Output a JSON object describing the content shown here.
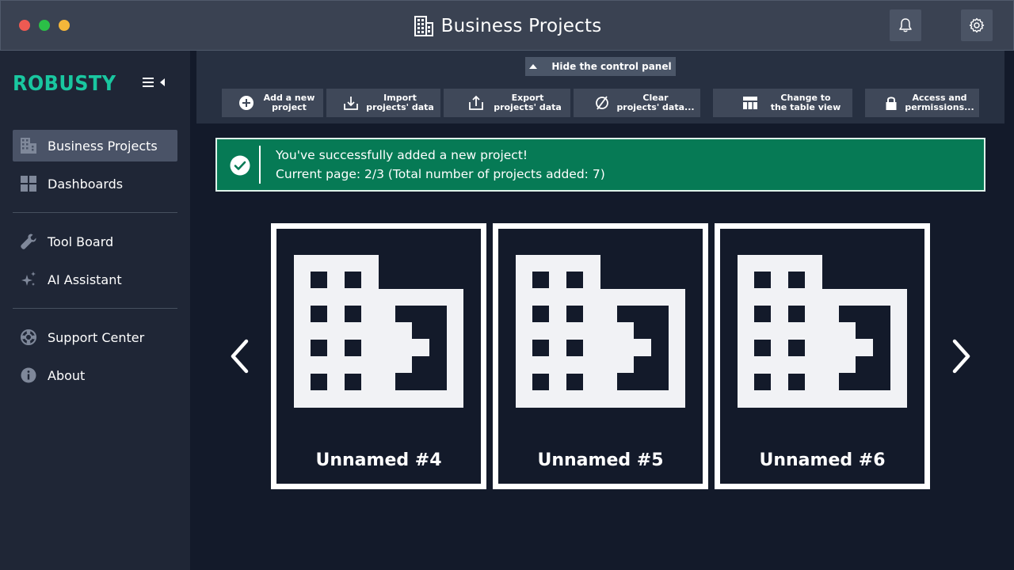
{
  "window": {
    "title": "Business Projects",
    "title_icon": "building-icon",
    "traffic_lights": [
      "#ee5a52",
      "#2bbf47",
      "#f5b73a"
    ],
    "notification_icon": "bell-icon",
    "settings_icon": "gear-icon"
  },
  "sidebar": {
    "logo": "ROBUSTY",
    "logo_color": "#19c7a0",
    "items": [
      {
        "label": "Business Projects",
        "icon": "building-icon",
        "active": true
      },
      {
        "label": "Dashboards",
        "icon": "grid-icon",
        "active": false
      },
      {
        "label": "Tool Board",
        "icon": "wrench-icon",
        "active": false
      },
      {
        "label": "AI Assistant",
        "icon": "sparkle-icon",
        "active": false
      },
      {
        "label": "Support Center",
        "icon": "lifebuoy-icon",
        "active": false
      },
      {
        "label": "About",
        "icon": "info-icon",
        "active": false
      }
    ]
  },
  "control_panel": {
    "hide_label": "Hide the control panel",
    "buttons": [
      {
        "line1": "Add a new",
        "line2": "project",
        "icon": "plus-circle-icon"
      },
      {
        "line1": "Import",
        "line2": "projects' data",
        "icon": "import-icon"
      },
      {
        "line1": "Export",
        "line2": "projects' data",
        "icon": "export-icon"
      },
      {
        "line1": "Clear",
        "line2": "projects' data...",
        "icon": "clear-icon"
      },
      {
        "line1": "Change to",
        "line2": "the table view",
        "icon": "table-icon"
      },
      {
        "line1": "Access and",
        "line2": "permissions...",
        "icon": "lock-icon"
      }
    ]
  },
  "notification": {
    "icon": "check-circle-icon",
    "line1": "You've successfully added a new project!",
    "line2": "Current page: 2/3 (Total number of projects added: 7)",
    "color": "#067a55"
  },
  "carousel": {
    "prev_icon": "chevron-left-icon",
    "next_icon": "chevron-right-icon",
    "cards": [
      {
        "title": "Unnamed #4",
        "icon": "building-icon"
      },
      {
        "title": "Unnamed #5",
        "icon": "building-icon"
      },
      {
        "title": "Unnamed #6",
        "icon": "building-icon"
      }
    ]
  }
}
